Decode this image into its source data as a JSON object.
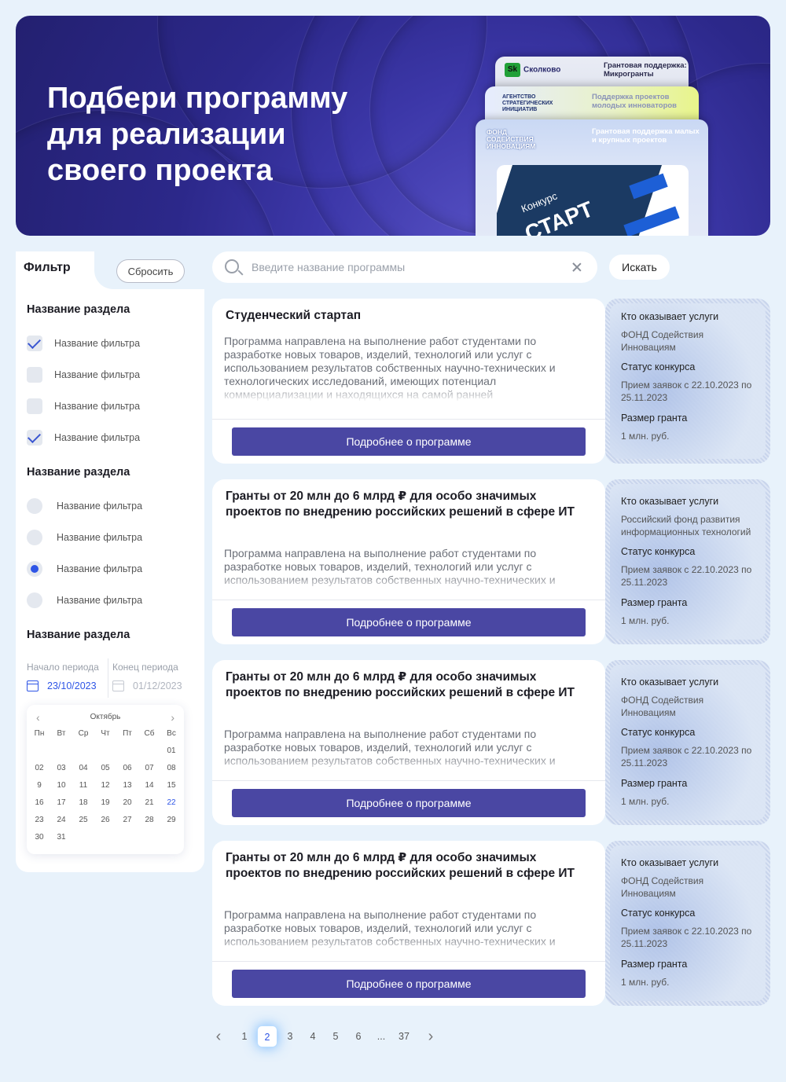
{
  "hero": {
    "title_lines": [
      "Подбери программу",
      "для реализации",
      "своего проекта"
    ],
    "promo_cards": [
      {
        "logo": "Сколково",
        "tag": "Грантовая поддержка: Микрогранты"
      },
      {
        "logo": "АГЕНТСТВО СТРАТЕГИЧЕСКИХ ИНИЦИАТИВ",
        "tag": "Поддержка проектов молодых инноваторов"
      },
      {
        "logo": "ФОНД СОДЕЙСТВИЯ ИННОВАЦИЯМ",
        "tag": "Грантовая поддержка малых и крупных проектов"
      }
    ],
    "start_card": {
      "line1": "Конкурс",
      "line2": "СТАРТ"
    }
  },
  "filter": {
    "title": "Фильтр",
    "reset_label": "Сбросить",
    "sections": [
      {
        "title": "Название раздела",
        "type": "checkbox",
        "options": [
          {
            "label": "Название фильтра",
            "checked": true
          },
          {
            "label": "Название фильтра",
            "checked": false
          },
          {
            "label": "Название фильтра",
            "checked": false
          },
          {
            "label": "Название фильтра",
            "checked": true
          }
        ]
      },
      {
        "title": "Название раздела",
        "type": "radio",
        "options": [
          {
            "label": "Название фильтра",
            "checked": false
          },
          {
            "label": "Название фильтра",
            "checked": false
          },
          {
            "label": "Название фильтра",
            "checked": true
          },
          {
            "label": "Название фильтра",
            "checked": false
          }
        ]
      },
      {
        "title": "Название раздела",
        "type": "period"
      }
    ],
    "period": {
      "start_label": "Начало периода",
      "start_value": "23/10/2023",
      "end_label": "Конец периода",
      "end_value": "01/12/2023"
    },
    "calendar": {
      "month": "Октябрь",
      "weekdays": [
        "Пн",
        "Вт",
        "Ср",
        "Чт",
        "Пт",
        "Сб",
        "Вс"
      ],
      "leading_blanks": 6,
      "days": [
        "01",
        "02",
        "03",
        "04",
        "05",
        "06",
        "07",
        "08",
        "9",
        "10",
        "11",
        "12",
        "13",
        "14",
        "15",
        "16",
        "17",
        "18",
        "19",
        "20",
        "21",
        "22",
        "23",
        "24",
        "25",
        "26",
        "27",
        "28",
        "29",
        "30",
        "31"
      ],
      "highlight_day": "22"
    }
  },
  "search": {
    "placeholder": "Введите название программы",
    "value": "",
    "button_label": "Искать"
  },
  "programs": [
    {
      "title": "Студенческий стартап",
      "description": "Программа направлена на выполнение работ студентами по разработке новых товаров, изделий, технологий или услуг с использованием результатов собственных научно-технических и технологических исследований, имеющих потенциал коммерциализации и находящихся на самой ранней",
      "button": "Подробнее о программе",
      "provider_label": "Кто оказывает услуги",
      "provider": "ФОНД Содействия Инновациям",
      "status_label": "Статус конкурса",
      "status": "Прием заявок с 22.10.2023 по 25.11.2023",
      "grant_label": "Размер гранта",
      "grant": "1 млн. руб."
    },
    {
      "title": "Гранты от 20 млн до 6 млрд ₽ для особо значимых проектов по внедрению российских решений в сфере ИТ",
      "description": "Программа направлена на выполнение работ студентами по разработке новых товаров, изделий, технологий или услуг с использованием результатов собственных научно-технических и",
      "button": "Подробнее о программе",
      "provider_label": "Кто оказывает услуги",
      "provider": "Российский фонд развития информационных технологий",
      "status_label": "Статус конкурса",
      "status": "Прием заявок с 22.10.2023 по 25.11.2023",
      "grant_label": "Размер гранта",
      "grant": "1 млн. руб."
    },
    {
      "title": "Гранты от 20 млн до 6 млрд ₽ для особо значимых проектов по внедрению российских решений в сфере ИТ",
      "description": "Программа направлена на выполнение работ студентами по разработке новых товаров, изделий, технологий или услуг с использованием результатов собственных научно-технических и",
      "button": "Подробнее о программе",
      "provider_label": "Кто оказывает услуги",
      "provider": "ФОНД Содействия Инновациям",
      "status_label": "Статус конкурса",
      "status": "Прием заявок с 22.10.2023 по 25.11.2023",
      "grant_label": "Размер гранта",
      "grant": "1 млн. руб."
    },
    {
      "title": "Гранты от 20 млн до 6 млрд ₽ для особо значимых проектов по внедрению российских решений в сфере ИТ",
      "description": "Программа направлена на выполнение работ студентами по разработке новых товаров, изделий, технологий или услуг с использованием результатов собственных научно-технических и",
      "button": "Подробнее о программе",
      "provider_label": "Кто оказывает услуги",
      "provider": "ФОНД Содействия Инновациям",
      "status_label": "Статус конкурса",
      "status": "Прием заявок с 22.10.2023 по 25.11.2023",
      "grant_label": "Размер гранта",
      "grant": "1 млн. руб."
    }
  ],
  "pagination": {
    "prev_icon": "chevron-left-icon",
    "next_icon": "chevron-right-icon",
    "pages": [
      "1",
      "2",
      "3",
      "4",
      "5",
      "6",
      "...",
      "37"
    ],
    "current": "2"
  },
  "colors": {
    "accent": "#4a47a3",
    "highlight": "#2e55e6",
    "background": "#e8f2fb"
  }
}
